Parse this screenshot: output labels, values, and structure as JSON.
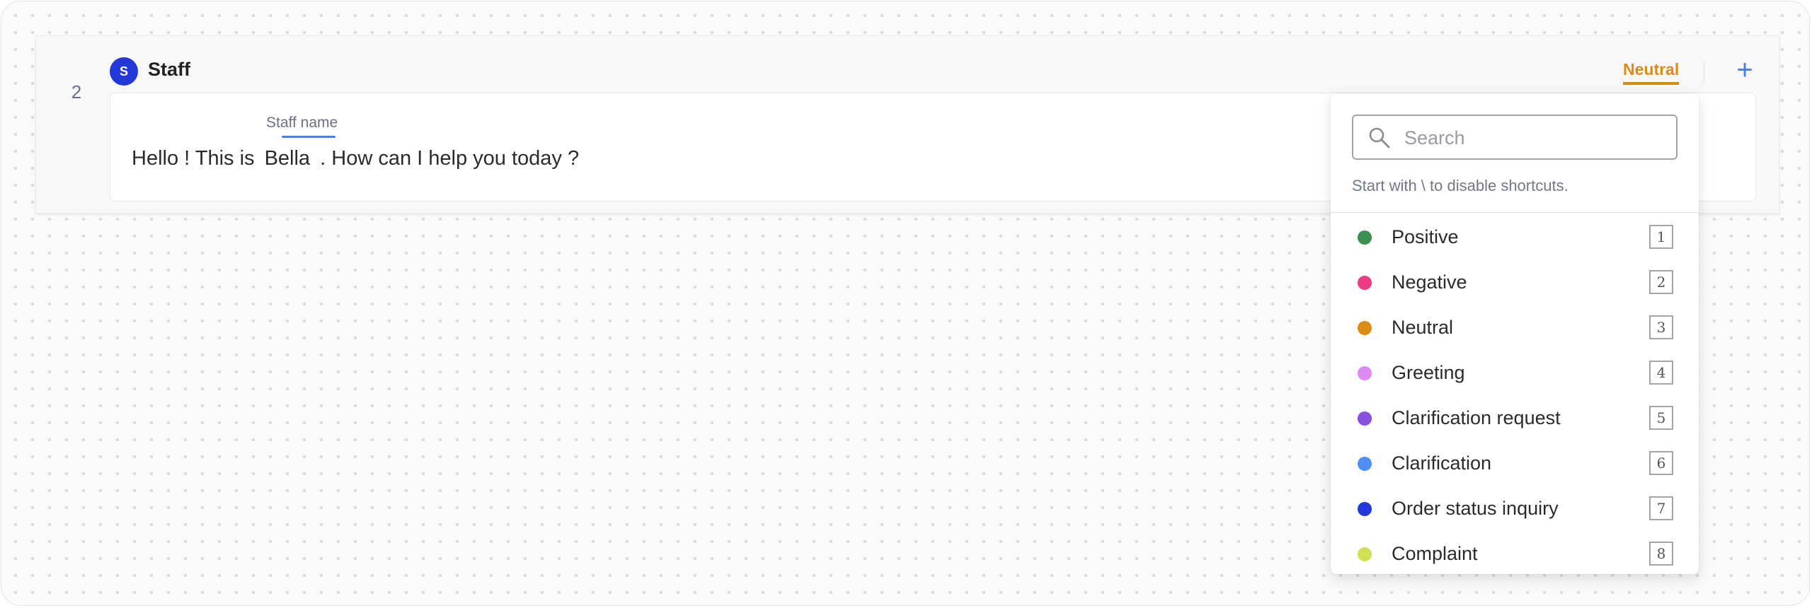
{
  "row": {
    "number": "2",
    "speaker_initial": "S",
    "speaker_name": "Staff",
    "sentiment_tag": "Neutral",
    "add_label": "+"
  },
  "message": {
    "entity_label": "Staff name",
    "text_before": "Hello ! This is ",
    "entity_text": "Bella",
    "text_after": " . How can I help you today ?"
  },
  "dropdown": {
    "search_placeholder": "Search",
    "search_value": "",
    "hint": "Start with \\ to disable shortcuts.",
    "options": [
      {
        "label": "Positive",
        "color": "#3d8f4f",
        "hotkey": "1"
      },
      {
        "label": "Negative",
        "color": "#ec3b82",
        "hotkey": "2"
      },
      {
        "label": "Neutral",
        "color": "#db8a13",
        "hotkey": "3"
      },
      {
        "label": "Greeting",
        "color": "#de8af5",
        "hotkey": "4"
      },
      {
        "label": "Clarification request",
        "color": "#8651de",
        "hotkey": "5"
      },
      {
        "label": "Clarification",
        "color": "#4f8ef5",
        "hotkey": "6"
      },
      {
        "label": "Order status inquiry",
        "color": "#2338d8",
        "hotkey": "7"
      },
      {
        "label": "Complaint",
        "color": "#cfe053",
        "hotkey": "8"
      }
    ]
  },
  "colors": {
    "accent": "#4a7de6",
    "avatar": "#2338d8",
    "sentiment": "#db8a13"
  }
}
